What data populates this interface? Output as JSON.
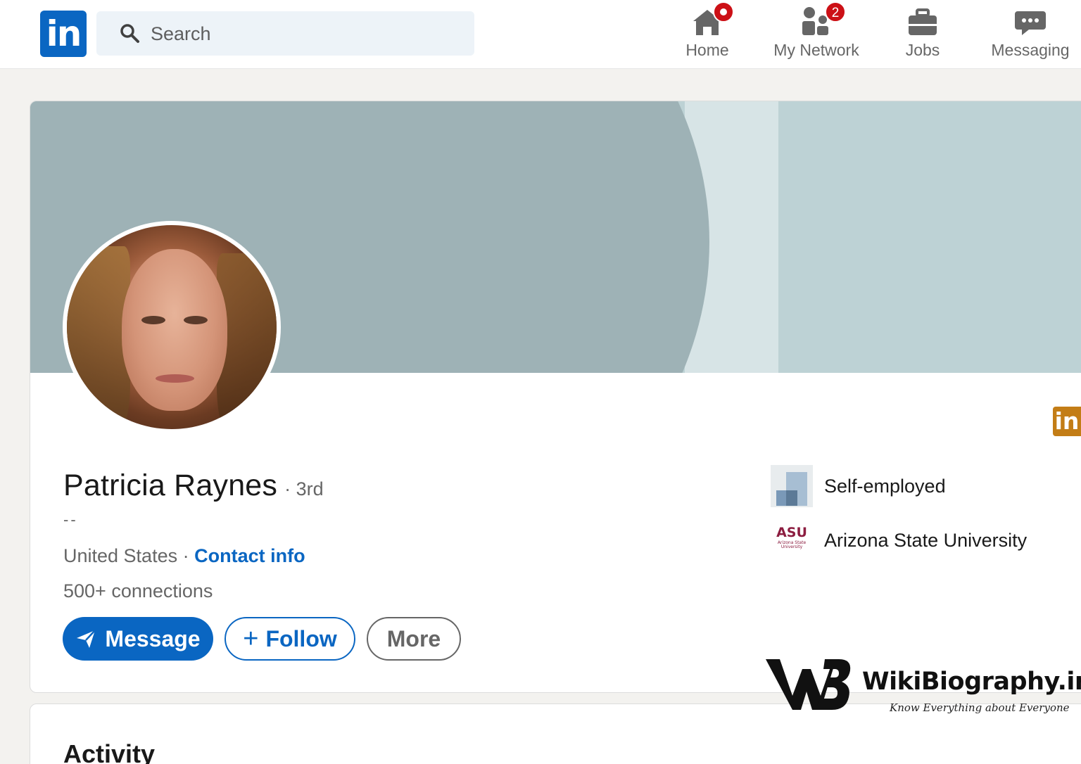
{
  "nav": {
    "logo_text": "in",
    "search_placeholder": "Search",
    "items": [
      {
        "label": "Home",
        "icon": "home-icon",
        "badge": ""
      },
      {
        "label": "My Network",
        "icon": "network-icon",
        "badge": "2"
      },
      {
        "label": "Jobs",
        "icon": "briefcase-icon",
        "badge": ""
      },
      {
        "label": "Messaging",
        "icon": "messaging-icon",
        "badge": ""
      }
    ]
  },
  "profile": {
    "name": "Patricia Raynes",
    "degree": "· 3rd",
    "headline": "--",
    "location": "United States ·",
    "contact_info": "Contact info",
    "connections": "500+ connections",
    "actions": {
      "message": "Message",
      "follow": "Follow",
      "more": "More"
    },
    "experience": [
      {
        "label": "Self-employed",
        "icon": "company-logo"
      },
      {
        "label": "Arizona State University",
        "icon": "asu-logo",
        "logo_text": "ASU",
        "logo_subtext": "Arizona State University"
      }
    ],
    "side_badge": "in"
  },
  "activity": {
    "title": "Activity"
  },
  "watermark": {
    "brand": "WikiBiography.in",
    "tagline": "Know Everything about Everyone"
  },
  "colors": {
    "brand_blue": "#0a66c2",
    "badge_red": "#cc1016",
    "banner_dark": "#9eb2b6",
    "banner_light": "#bdd2d5",
    "asu_maroon": "#8c1d40",
    "side_badge": "#c37d16"
  }
}
